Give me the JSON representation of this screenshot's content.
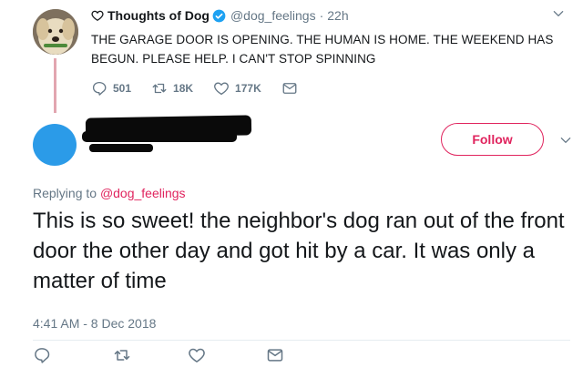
{
  "original_tweet": {
    "display_name": "Thoughts of Dog",
    "handle": "@dog_feelings",
    "separator": "·",
    "time": "22h",
    "text": "THE GARAGE DOOR IS OPENING. THE HUMAN IS HOME. THE WEEKEND HAS BEGUN. PLEASE HELP. I CAN'T STOP SPINNING",
    "reply_count": "501",
    "retweet_count": "18K",
    "like_count": "177K"
  },
  "reply_tweet": {
    "follow_label": "Follow",
    "replying_prefix": "Replying to",
    "replying_mention": "@dog_feelings",
    "text": "This is so sweet! the neighbor's dog ran out of the front door the other day and got hit by a car. It was only a matter of time",
    "timestamp": "4:41 AM - 8 Dec 2018"
  },
  "colors": {
    "accent": "#e0245e",
    "muted": "#657786",
    "text": "#14171a",
    "verified": "#1da1f2",
    "avatar_placeholder": "#2b9be8",
    "thread_line": "#e2a6b0"
  },
  "icons": [
    "heart-icon",
    "verified-icon",
    "chevron-down-icon",
    "reply-icon",
    "retweet-icon",
    "like-icon",
    "message-icon"
  ]
}
